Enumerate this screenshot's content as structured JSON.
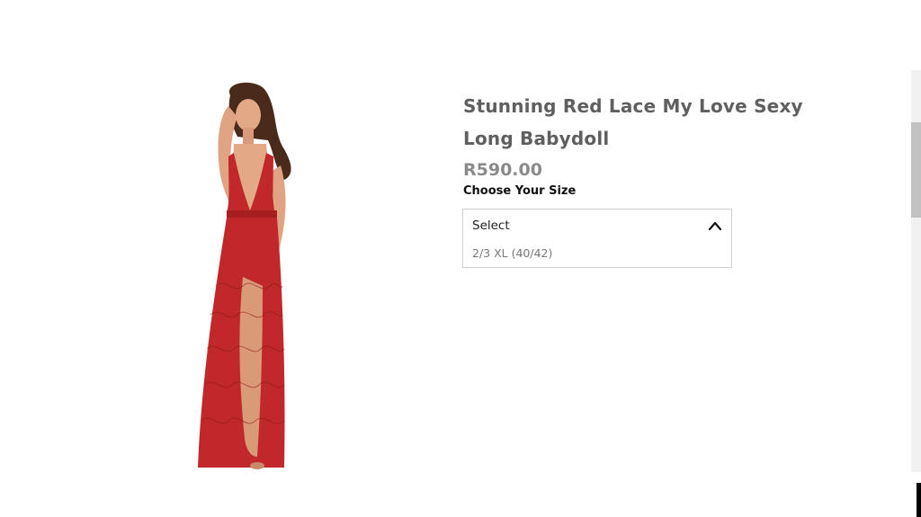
{
  "product": {
    "title": "Stunning Red Lace My Love Sexy Long Babydoll",
    "price": "R590.00",
    "image_subject": "model-in-red-lace-long-babydoll"
  },
  "size_selector": {
    "label": "Choose Your Size",
    "selected": "Select",
    "options": [
      "2/3 XL (40/42)"
    ],
    "expanded": true
  },
  "colors": {
    "title": "#5f5f5f",
    "price": "#8a8a8a",
    "dress": "#c0282b"
  }
}
